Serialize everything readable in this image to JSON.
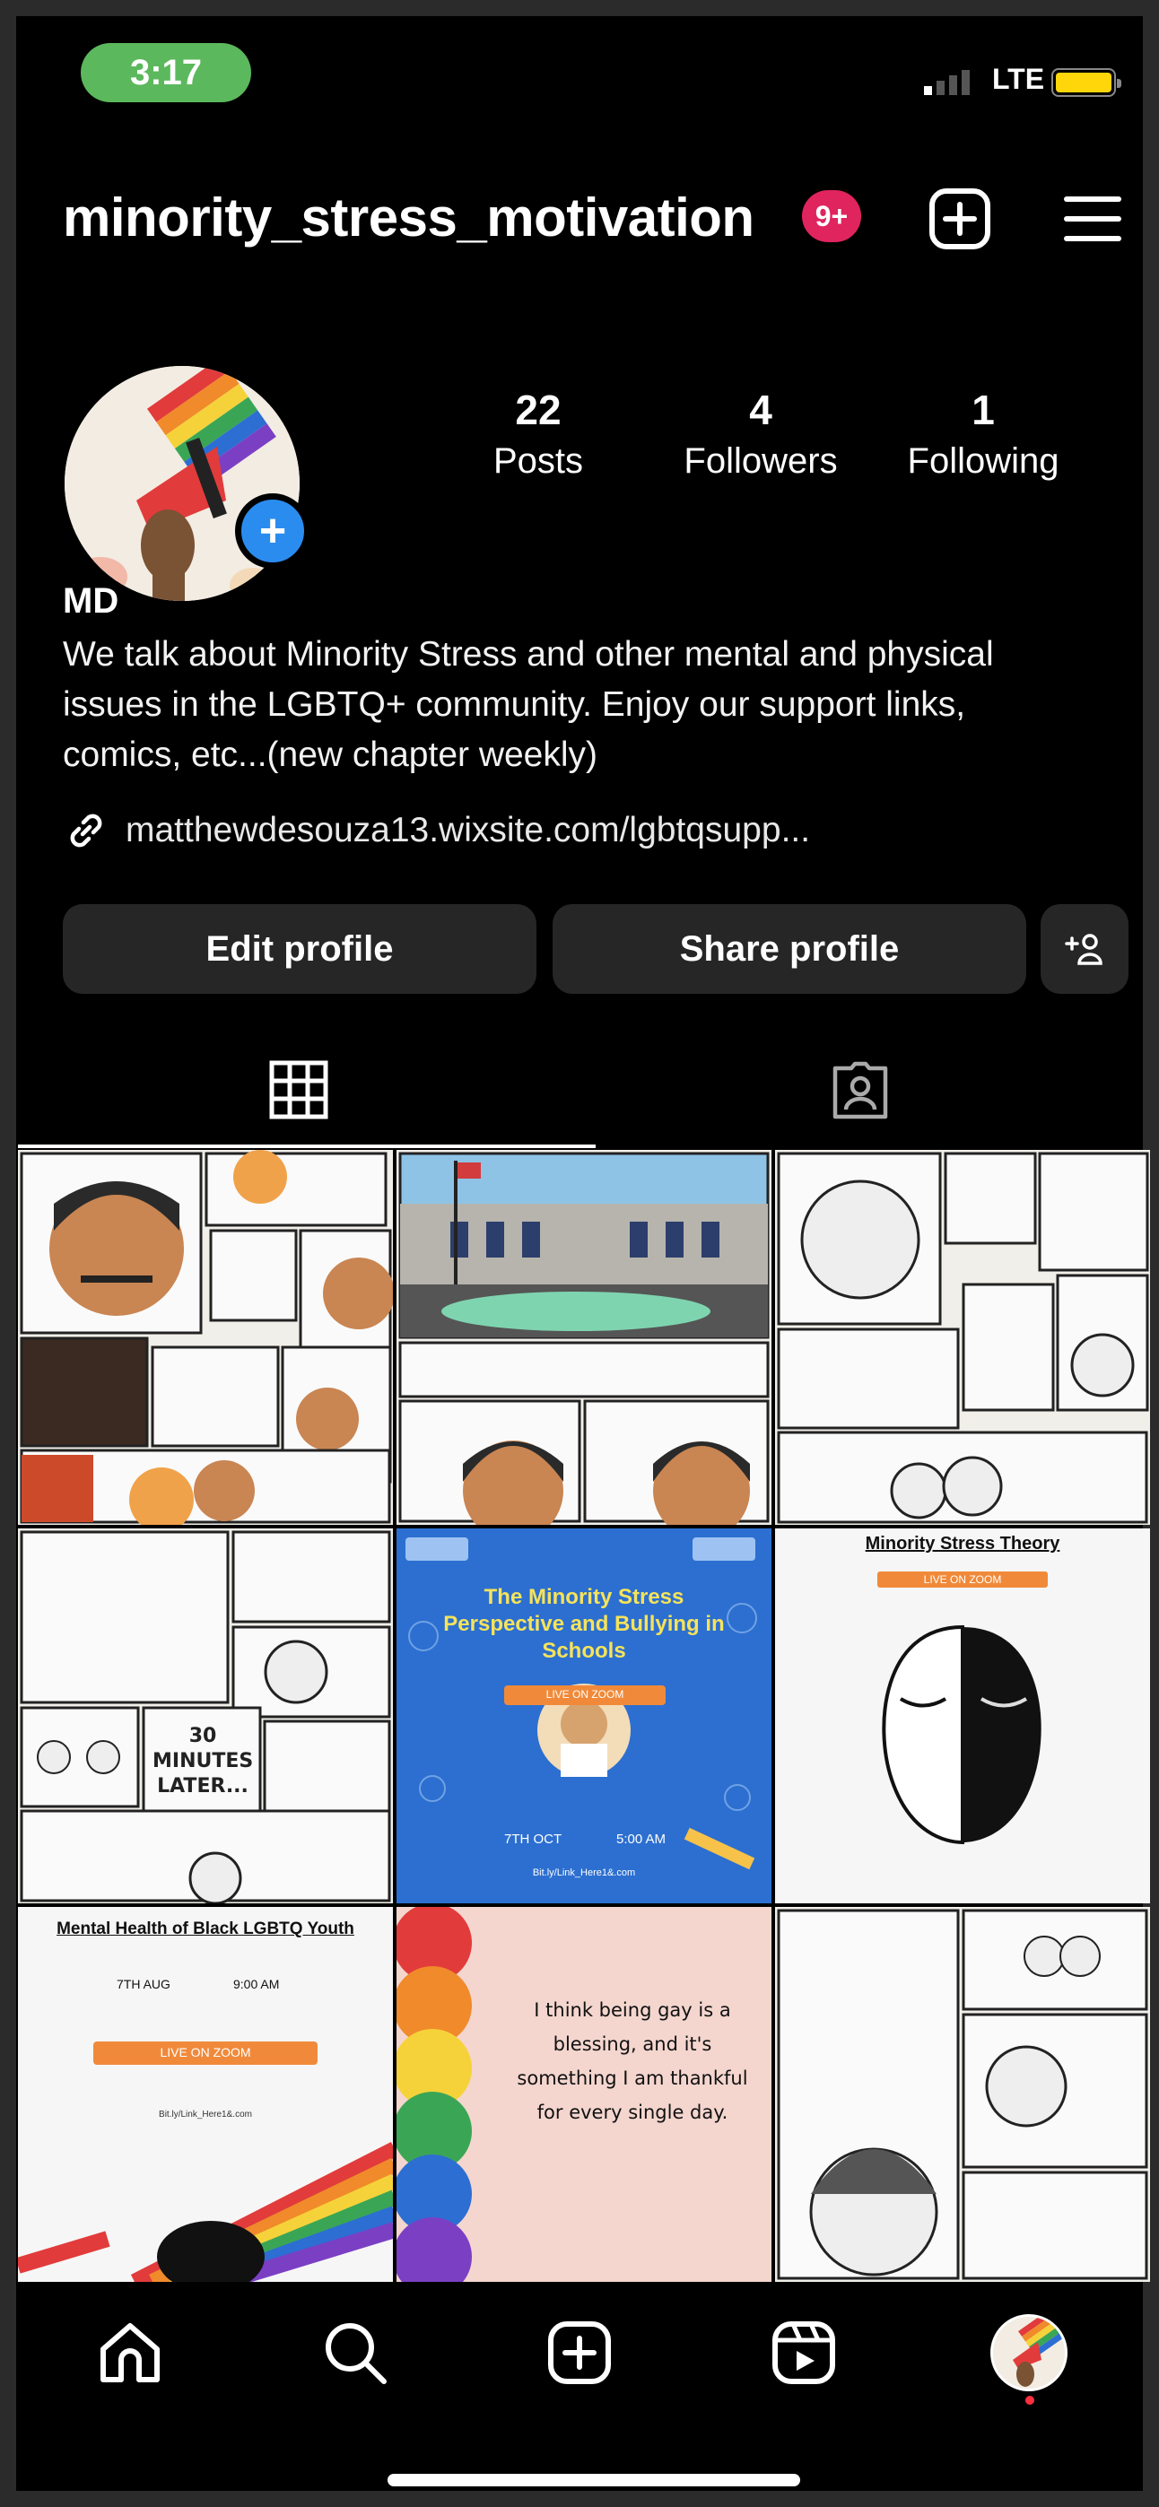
{
  "status_bar": {
    "time": "3:17",
    "network": "LTE"
  },
  "header": {
    "username": "minority_stress_motivation",
    "notification_count": "9+"
  },
  "profile": {
    "stats": [
      {
        "value": "22",
        "label": "Posts"
      },
      {
        "value": "4",
        "label": "Followers"
      },
      {
        "value": "1",
        "label": "Following"
      }
    ],
    "display_name": "MD",
    "bio": "We talk about Minority Stress and other mental and physical issues in the LGBTQ+ community. Enjoy our support links, comics, etc...(new chapter weekly)",
    "link": "matthewdesouza13.wixsite.com/lgbtqsupp...",
    "buttons": {
      "edit": "Edit profile",
      "share": "Share profile"
    }
  },
  "tabs": [
    {
      "name": "grid-tab",
      "icon": "grid-icon",
      "active": true
    },
    {
      "name": "tagged-tab",
      "icon": "tagged-person-icon",
      "active": false
    }
  ],
  "posts": {
    "p5": {
      "title": "The Minority Stress Perspective and Bullying in Schools",
      "badge": "LIVE ON ZOOM",
      "date": "7TH OCT",
      "time": "5:00 AM",
      "link": "Bit.ly/Link_Here1&.com"
    },
    "p6": {
      "title": "Minority Stress Theory",
      "badge": "LIVE ON ZOOM"
    },
    "p7": {
      "title": "Mental Health of Black LGBTQ Youth",
      "date": "7TH AUG",
      "time": "9:00 AM",
      "badge": "LIVE ON ZOOM",
      "link": "Bit.ly/Link_Here1&.com"
    },
    "p8": {
      "quote": "I think being gay is a blessing, and it's something I am thankful for every single day."
    },
    "p4": {
      "caption": "30 MINUTES LATER..."
    }
  },
  "bottom_nav": [
    "home-icon",
    "search-icon",
    "create-icon",
    "reels-icon",
    "profile-avatar"
  ],
  "colors": {
    "accent_blue": "#2b8cf0",
    "badge_red": "#e0245e",
    "button_bg": "#262626",
    "time_pill": "#5cb85c"
  }
}
